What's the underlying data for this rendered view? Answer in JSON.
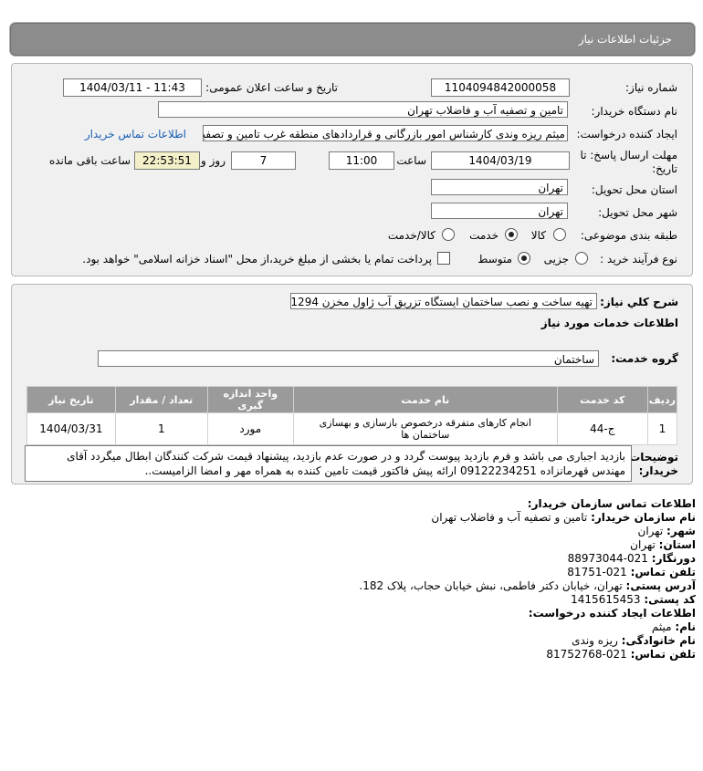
{
  "header": {
    "title": "جزئیات اطلاعات نیاز"
  },
  "form": {
    "need_number_label": "شماره نیاز:",
    "need_number": "1104094842000058",
    "announce_label": "تاریخ و ساعت اعلان عمومی:",
    "announce_value": "1404/03/11 - 11:43",
    "buyer_label": "نام دستگاه خریدار:",
    "buyer_value": "تامین و تصفیه آب و فاضلاب تهران",
    "creator_label": "ایجاد کننده درخواست:",
    "creator_value": "میثم ریزه وندی کارشناس امور بازرگانی و قراردادهای منطقه غرب تامین و تصفیه",
    "contact_link": "اطلاعات تماس خریدار",
    "deadline_label_1": "مهلت ارسال پاسخ: تا",
    "deadline_label_2": "تاریخ:",
    "deadline_date": "1404/03/19",
    "time_label": "ساعت",
    "deadline_time": "11:00",
    "days_value": "7",
    "days_label": "روز و",
    "remaining_time": "22:53:51",
    "remaining_label": "ساعت باقی مانده",
    "province_label": "استان محل تحویل:",
    "province_value": "تهران",
    "city_label": "شهر محل تحویل:",
    "city_value": "تهران",
    "category_label": "طبقه بندی موضوعی:",
    "category_options": [
      "کالا",
      "خدمت",
      "کالا/خدمت"
    ],
    "category_selected": "خدمت",
    "process_label": "نوع فرآیند خرید :",
    "process_options": [
      "جزیی",
      "متوسط"
    ],
    "process_selected": "متوسط",
    "payment_text": "پرداخت تمام یا بخشی از مبلغ خرید،از محل \"اسناد خزانه اسلامی\" خواهد بود."
  },
  "details": {
    "desc_label": "شرح کلي نياز:",
    "desc_value": "تهیه ساخت و نصب ساختمان ایستگاه تزریق آب ژاول مخزن 1294",
    "services_title": "اطلاعات خدمات مورد نیاز",
    "group_label": "گروه خدمت:",
    "group_value": "ساختمان",
    "table_headers": [
      "ردیف",
      "کد خدمت",
      "نام خدمت",
      "واحد اندازه گیری",
      "تعداد / مقدار",
      "تاریخ نیاز"
    ],
    "table_rows": [
      {
        "row": "1",
        "code": "ج-44",
        "name": "انجام کارهای متفرقه درخصوص بازسازی و بهسازی ساختمان ها",
        "unit": "مورد",
        "qty": "1",
        "date": "1404/03/31"
      }
    ],
    "notes_label_1": "توضیحات",
    "notes_label_2": "خریدار:",
    "notes_text": "بازدید اجباری می باشد و فرم بازدید پیوست گردد و در صورت عدم بازدید، پیشنهاد قیمت شرکت کنندگان ابطال میگردد آقای مهندس قهرمانزاده 09122234251 ارائه پیش فاکتور قیمت تامین کننده به همراه مهر و امضا الزامیست.."
  },
  "contact": {
    "title": "اطلاعات تماس سازمان خریدار:",
    "org_label": "نام سازمان خریدار:",
    "org_value": "تامین و تصفیه آب و فاضلاب تهران",
    "city_label": "شهر:",
    "city_value": "تهران",
    "province_label": "استان:",
    "province_value": "تهران",
    "fax_label": "دورنگار:",
    "fax_value": "021-88973044",
    "phone_label": "تلفن تماس:",
    "phone_value": "021-81751",
    "address_label": "آدرس پستی:",
    "address_value": "تهران، خیابان دکتر فاطمی، نبش خیابان حجاب، پلاک 182.",
    "postal_label": "کد پستی:",
    "postal_value": "1415615453",
    "creator_title": "اطلاعات ایجاد کننده درخواست:",
    "name_label": "نام:",
    "name_value": "میثم",
    "family_label": "نام خانوادگی:",
    "family_value": "ریزه وندی",
    "creator_phone_label": "تلفن تماس:",
    "creator_phone_value": "021-81752768"
  }
}
